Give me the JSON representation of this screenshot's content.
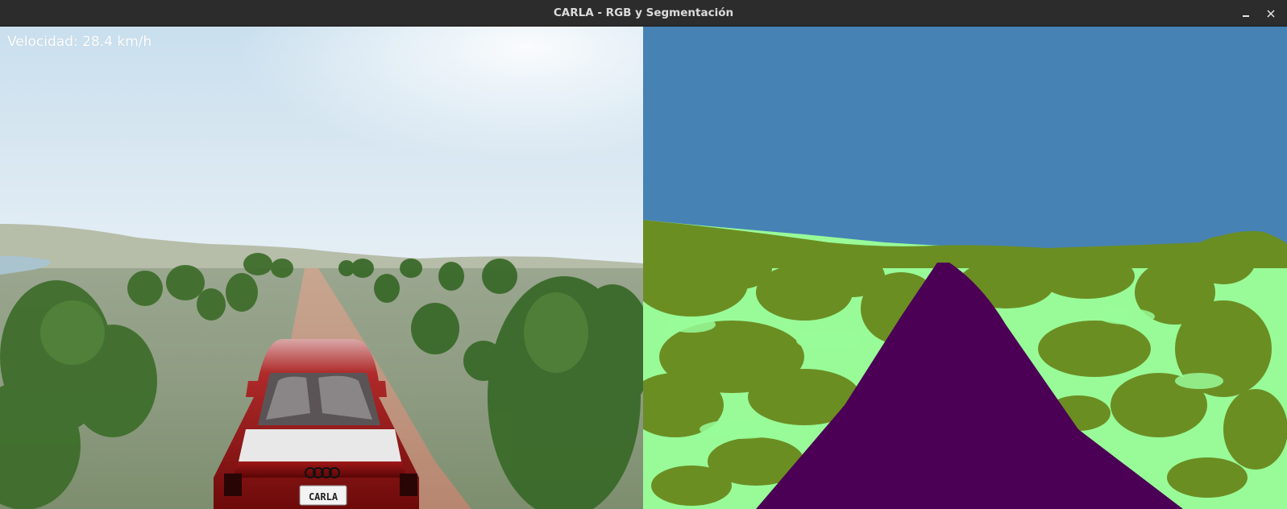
{
  "window": {
    "title": "CARLA - RGB y Segmentación",
    "minimize_icon": "minimize-icon",
    "close_icon": "close-icon"
  },
  "rgb_view": {
    "speed_text": "Velocidad: 28.4 km/h",
    "license_plate": "CARLA"
  },
  "segmentation_view": {
    "class_colors": {
      "sky": "#4682b4",
      "vegetation": "#6b8e23",
      "terrain": "#98fb98",
      "road": "#4b0055",
      "water": "#2d2d8c"
    }
  }
}
